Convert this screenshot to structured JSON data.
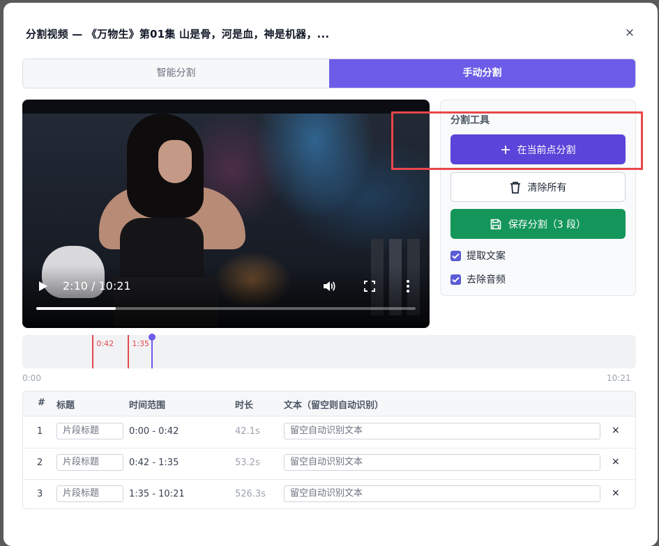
{
  "dialog": {
    "title": "分割视频 — 《万物生》第01集 山是骨，河是血，神是机器，...",
    "close": "×"
  },
  "tabs": [
    {
      "label": "智能分割",
      "active": false
    },
    {
      "label": "手动分割",
      "active": true
    }
  ],
  "video": {
    "time": "2:10 / 10:21",
    "progress": 0.21
  },
  "tools": {
    "title": "分割工具",
    "split_label": "在当前点分割",
    "clear_label": "清除所有",
    "save_label": "保存分割（3 段）",
    "extract_label": "提取文案",
    "extract_checked": true,
    "remove_audio_label": "去除音频",
    "remove_audio_checked": true
  },
  "timeline": {
    "start": "0:00",
    "end": "10:21",
    "markers": [
      "0:42",
      "1:35"
    ],
    "playhead": "2:10"
  },
  "table": {
    "headers": {
      "idx": "#",
      "title": "标题",
      "range": "时间范围",
      "duration": "时长",
      "text": "文本（留空则自动识别）"
    },
    "rows": [
      {
        "idx": "1",
        "title_placeholder": "片段标题",
        "range": "0:00 - 0:42",
        "duration": "42.1s",
        "text_placeholder": "留空自动识别文本",
        "delete": "×"
      },
      {
        "idx": "2",
        "title_placeholder": "片段标题",
        "range": "0:42 - 1:35",
        "duration": "53.2s",
        "text_placeholder": "留空自动识别文本",
        "delete": "×"
      },
      {
        "idx": "3",
        "title_placeholder": "片段标题",
        "range": "1:35 - 10:21",
        "duration": "526.3s",
        "text_placeholder": "留空自动识别文本",
        "delete": "×"
      }
    ]
  },
  "colors": {
    "accent": "#6c5ce7",
    "split_button": "#5b44d9",
    "save_button": "#14965a",
    "marker": "#e5484d",
    "highlight": "#e8474a"
  }
}
